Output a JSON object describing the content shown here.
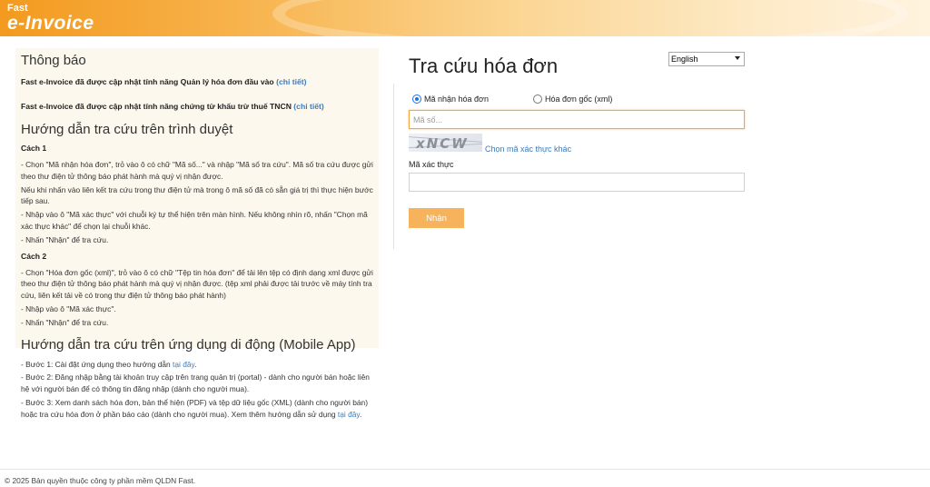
{
  "header": {
    "logo_small": "Fast",
    "logo_big": "e-Invoice"
  },
  "notice": {
    "heading": "Thông báo",
    "items": [
      {
        "text": "Fast e-Invoice đã được cập nhật tính năng Quản lý hóa đơn đầu vào ",
        "link": "(chi tiết)"
      },
      {
        "text": "Fast e-Invoice đã được cập nhật tính năng chứng từ khấu trừ thuế TNCN ",
        "link": "(chi tiết)"
      }
    ]
  },
  "browser_guide": {
    "heading": "Hướng dẫn tra cứu trên trình duyệt",
    "method1_title": "Cách 1",
    "method1_lines": [
      "- Chọn \"Mã nhận hóa đơn\", trỏ vào ô có chữ \"Mã số...\" và nhập \"Mã số tra cứu\". Mã số tra cứu được gửi theo thư điện tử thông báo phát hành mà quý vị nhận được.",
      "Nếu khi nhấn vào liên kết tra cứu trong thư điện tử mà trong ô mã số đã có sẵn giá trị thì thực hiện bước tiếp sau.",
      "- Nhập vào ô \"Mã xác thực\" với chuỗi ký tự thể hiện trên màn hình. Nếu không nhìn rõ, nhấn \"Chọn mã xác thực khác\" để chọn lại chuỗi khác.",
      "- Nhấn \"Nhận\" để tra cứu."
    ],
    "method2_title": "Cách 2",
    "method2_lines": [
      "- Chọn \"Hóa đơn gốc (xml)\", trỏ vào ô có chữ \"Tệp tin hóa đơn\" để tải lên tệp có định dạng xml được gửi theo thư điện tử thông báo phát hành mà quý vị nhận được. (tệp xml phải được tải trước về máy tính tra cứu, liên kết tải về có trong thư điện tử thông báo phát hành)",
      "- Nhập vào ô \"Mã xác thực\".",
      "- Nhấn \"Nhận\" để tra cứu."
    ]
  },
  "mobile_guide": {
    "heading": "Hướng dẫn tra cứu trên ứng dụng di động (Mobile App)",
    "step1_text": "- Bước 1: Cài đặt ứng dụng theo hướng dẫn ",
    "step1_link": "tại đây",
    "step2_text": "- Bước 2: Đăng nhập bằng tài khoản truy cập trên trang quản trị (portal) - dành cho người bán hoặc liên hệ với người bán để có thông tin đăng nhập (dành cho người mua).",
    "step3_text": "- Bước 3: Xem danh sách hóa đơn, bản thể hiện (PDF) và tệp dữ liệu gốc (XML) (dành cho người bán) hoặc tra cứu hóa đơn ở phần báo cáo (dành cho người mua). Xem thêm hướng dẫn sử dụng ",
    "step3_link": "tại đây"
  },
  "lookup": {
    "title": "Tra cứu hóa đơn",
    "language": "English",
    "radio_code": "Mã nhận hóa đơn",
    "radio_xml": "Hóa đơn gốc (xml)",
    "code_placeholder": "Mã số...",
    "captcha_text": "xNCW",
    "captcha_refresh": "Chọn mã xác thực khác",
    "captcha_label": "Mã xác thực",
    "captcha_value": "",
    "submit": "Nhận"
  },
  "footer": {
    "copyright": "© 2025 Bản quyền thuộc công ty phần mềm QLDN Fast."
  }
}
